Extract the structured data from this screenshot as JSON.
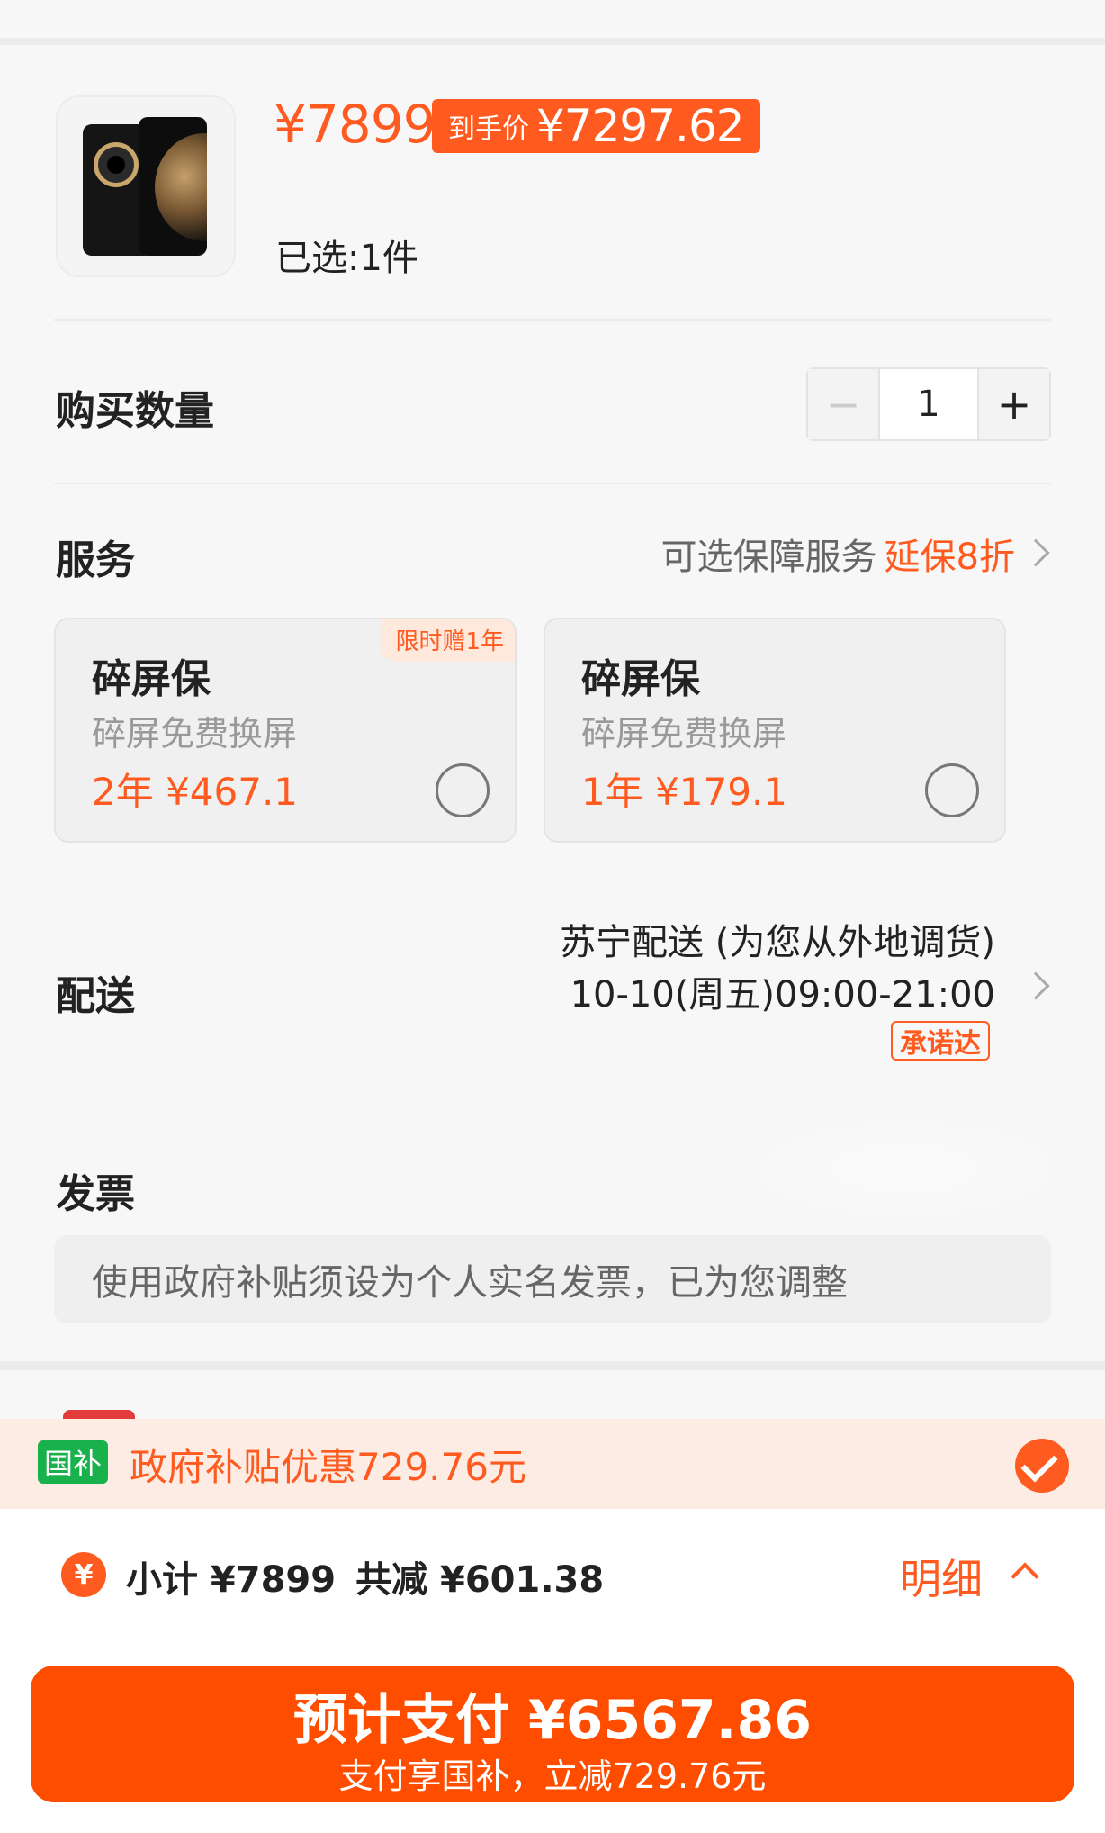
{
  "product": {
    "image_icon": "phone-product-image",
    "price": "¥7899",
    "net_price_label": "到手价",
    "net_price": "¥7297.62",
    "selected_text": "已选:1件"
  },
  "quantity": {
    "title": "购买数量",
    "minus": "−",
    "value": "1",
    "plus": "+"
  },
  "service": {
    "title": "服务",
    "optional_text": "可选保障服务",
    "discount_text": "延保8折",
    "options": [
      {
        "title": "碎屏保",
        "desc": "碎屏免费换屏",
        "price": "2年  ¥467.1",
        "promo": "限时赠1年"
      },
      {
        "title": "碎屏保",
        "desc": "碎屏免费换屏",
        "price": "1年  ¥179.1",
        "promo": ""
      }
    ]
  },
  "delivery": {
    "title": "配送",
    "line1": "苏宁配送 (为您从外地调货)",
    "line2": "10-10(周五)09:00-21:00",
    "badge": "承诺达"
  },
  "invoice": {
    "title": "发票",
    "note": "使用政府补贴须设为个人实名发票，已为您调整"
  },
  "subsidy": {
    "badge": "国补",
    "text": "政府补贴优惠729.76元"
  },
  "summary": {
    "coin": "¥",
    "subtotal": "小计 ¥7899",
    "reduction": "共减 ¥601.38",
    "detail": "明细"
  },
  "pay": {
    "main": "预计支付 ¥6567.86",
    "sub": "支付享国补，立减729.76元"
  },
  "colors": {
    "accent": "#ff5a1f",
    "pay_button": "#ff4d00",
    "gov_badge": "#18b14b"
  }
}
